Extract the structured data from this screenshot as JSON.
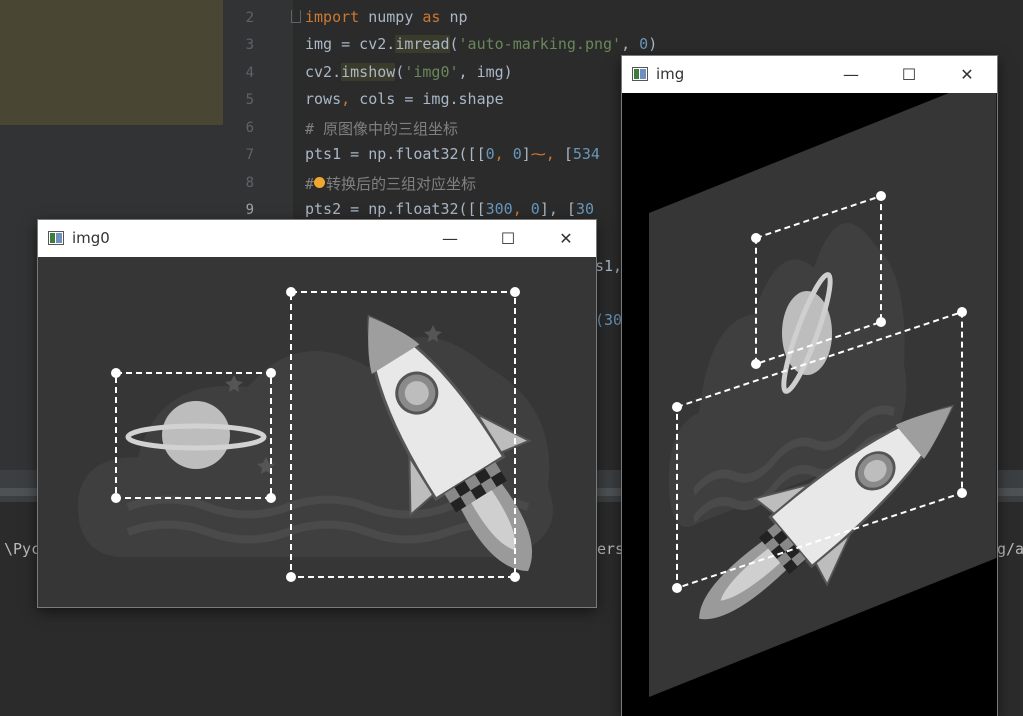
{
  "editor": {
    "line_numbers": [
      "2",
      "3",
      "4",
      "5",
      "6",
      "7",
      "8",
      "9"
    ],
    "line2": {
      "kw1": "import",
      "mid": " numpy ",
      "kw2": "as",
      "end": " np"
    },
    "line3": {
      "a": "img = cv2.",
      "b": "imread",
      "c": "(",
      "s": "'auto-marking.png'",
      "d": ", ",
      "n": "0",
      "e": ")"
    },
    "line4": {
      "a": "cv2.",
      "b": "imshow",
      "c": "(",
      "s": "'img0'",
      "d": ", img)"
    },
    "line5": {
      "a": "rows",
      "b": ", ",
      "c": "cols = img.shape"
    },
    "line6": {
      "c": "# 原图像中的三组坐标"
    },
    "line7": {
      "a": "pts1 = np.float32([[",
      "n1": "0",
      "s1": ", ",
      "n2": "0",
      "b": "]",
      "w": "⁓,",
      "c": " [",
      "n3": "534"
    },
    "line8": {
      "c1": "#",
      "c2": "转换后的三组对应坐标"
    },
    "line9": {
      "a": "pts2 = np.float32([[",
      "n1": "300",
      "s1": ", ",
      "n2": "0",
      "b": "], [",
      "n3": "30"
    },
    "fragments": {
      "s1": "s1,",
      "p30": "(30"
    }
  },
  "console": {
    "path_left": "\\Pyc",
    "path_mid": "ers",
    "path_right": "g/a"
  },
  "window_img0": {
    "title": "img0",
    "minimize": "—",
    "maximize": "☐",
    "close": "✕"
  },
  "window_img": {
    "title": "img",
    "minimize": "—",
    "maximize": "☐",
    "close": "✕"
  },
  "colors": {
    "ide_bg": "#2b2b2b",
    "keyword": "#cc7832",
    "string": "#6a8759",
    "number": "#6897bb",
    "comment": "#808080",
    "titlebar": "#ffffff",
    "marker": "#ffffff"
  }
}
